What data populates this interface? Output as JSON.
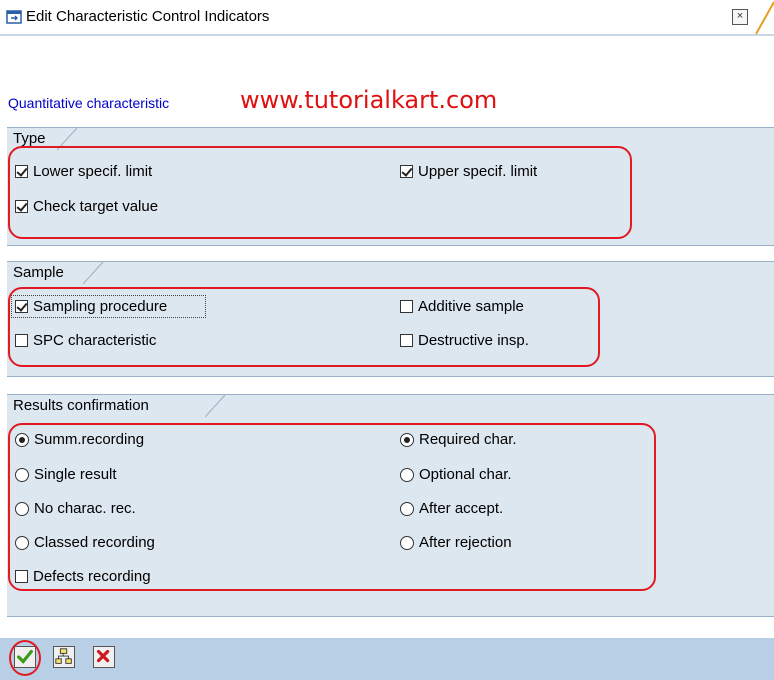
{
  "window": {
    "title": "Edit Characteristic Control Indicators",
    "close_glyph": "×",
    "title_icon": "edit-window-icon"
  },
  "header": {
    "characteristic_type": "Quantitative characteristic",
    "watermark": "www.tutorialkart.com"
  },
  "type_group": {
    "title": "Type",
    "lower_limit": {
      "label": "Lower specif. limit",
      "checked": true
    },
    "upper_limit": {
      "label": "Upper specif. limit",
      "checked": true
    },
    "check_target": {
      "label": "Check target value",
      "checked": true
    }
  },
  "sample_group": {
    "title": "Sample",
    "sampling_procedure": {
      "label": "Sampling procedure",
      "checked": true
    },
    "additive_sample": {
      "label": "Additive sample",
      "checked": false
    },
    "spc_characteristic": {
      "label": "SPC characteristic",
      "checked": false
    },
    "destructive_insp": {
      "label": "Destructive insp.",
      "checked": false
    }
  },
  "results_group": {
    "title": "Results confirmation",
    "recording_options": [
      {
        "label": "Summ.recording",
        "selected": true
      },
      {
        "label": "Single result",
        "selected": false
      },
      {
        "label": "No charac. rec.",
        "selected": false
      },
      {
        "label": "Classed recording",
        "selected": false
      }
    ],
    "char_options": [
      {
        "label": "Required char.",
        "selected": true
      },
      {
        "label": "Optional char.",
        "selected": false
      },
      {
        "label": "After accept.",
        "selected": false
      },
      {
        "label": "After rejection",
        "selected": false
      }
    ],
    "defects_recording": {
      "label": "Defects recording",
      "checked": false
    }
  },
  "footer": {
    "buttons": [
      "confirm-check-icon",
      "hierarchy-icon",
      "cancel-x-icon"
    ]
  },
  "colors": {
    "accent_red": "#e21b23",
    "link_blue": "#0000cc",
    "panel_bg": "#dde7f0",
    "footer_bg": "#b8cfe6"
  }
}
